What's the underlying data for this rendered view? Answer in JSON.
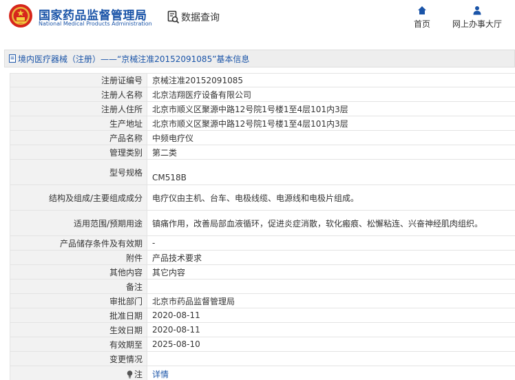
{
  "header": {
    "brand_cn": "国家药品监督管理局",
    "brand_en": "National Medical Products Administration",
    "query_label": "数据查询",
    "home_label": "首页",
    "hall_label": "网上办事大厅",
    "brand_color": "#1a54a8",
    "icons": [
      "national-emblem-icon",
      "search-doc-icon",
      "home-icon",
      "user-icon"
    ]
  },
  "title_bar": {
    "text": "境内医疗器械（注册）——“京械注准20152091085”基本信息",
    "icon": "document-icon"
  },
  "rows": [
    {
      "key": "注册证编号",
      "value": "京械注准20152091085"
    },
    {
      "key": "注册人名称",
      "value": "北京洁翔医疗设备有限公司"
    },
    {
      "key": "注册人住所",
      "value": "北京市顺义区聚源中路12号院1号楼1至4层101内3层"
    },
    {
      "key": "生产地址",
      "value": "北京市顺义区聚源中路12号院1号楼1至4层101内3层"
    },
    {
      "key": "产品名称",
      "value": "中频电疗仪"
    },
    {
      "key": "管理类别",
      "value": "第二类"
    },
    {
      "key": "型号规格",
      "value": "CM518B"
    },
    {
      "key": "结构及组成/主要组成成分",
      "value": "电疗仪由主机、台车、电极线缆、电源线和电极片组成。"
    },
    {
      "key": "适用范围/预期用途",
      "value": "镇痛作用，改善局部血液循环，促进炎症消散，软化瘢痕、松懈粘连、兴奋神经肌肉组织。"
    },
    {
      "key": "产品储存条件及有效期",
      "value": "-"
    },
    {
      "key": "附件",
      "value": "产品技术要求"
    },
    {
      "key": "其他内容",
      "value": "其它内容"
    },
    {
      "key": "备注",
      "value": ""
    },
    {
      "key": "审批部门",
      "value": "北京市药品监督管理局"
    },
    {
      "key": "批准日期",
      "value": "2020-08-11"
    },
    {
      "key": "生效日期",
      "value": "2020-08-11"
    },
    {
      "key": "有效期至",
      "value": "2025-08-10"
    },
    {
      "key": "变更情况",
      "value": ""
    },
    {
      "key": "注",
      "value": "详情",
      "key_icon": "lightbulb-icon"
    }
  ]
}
